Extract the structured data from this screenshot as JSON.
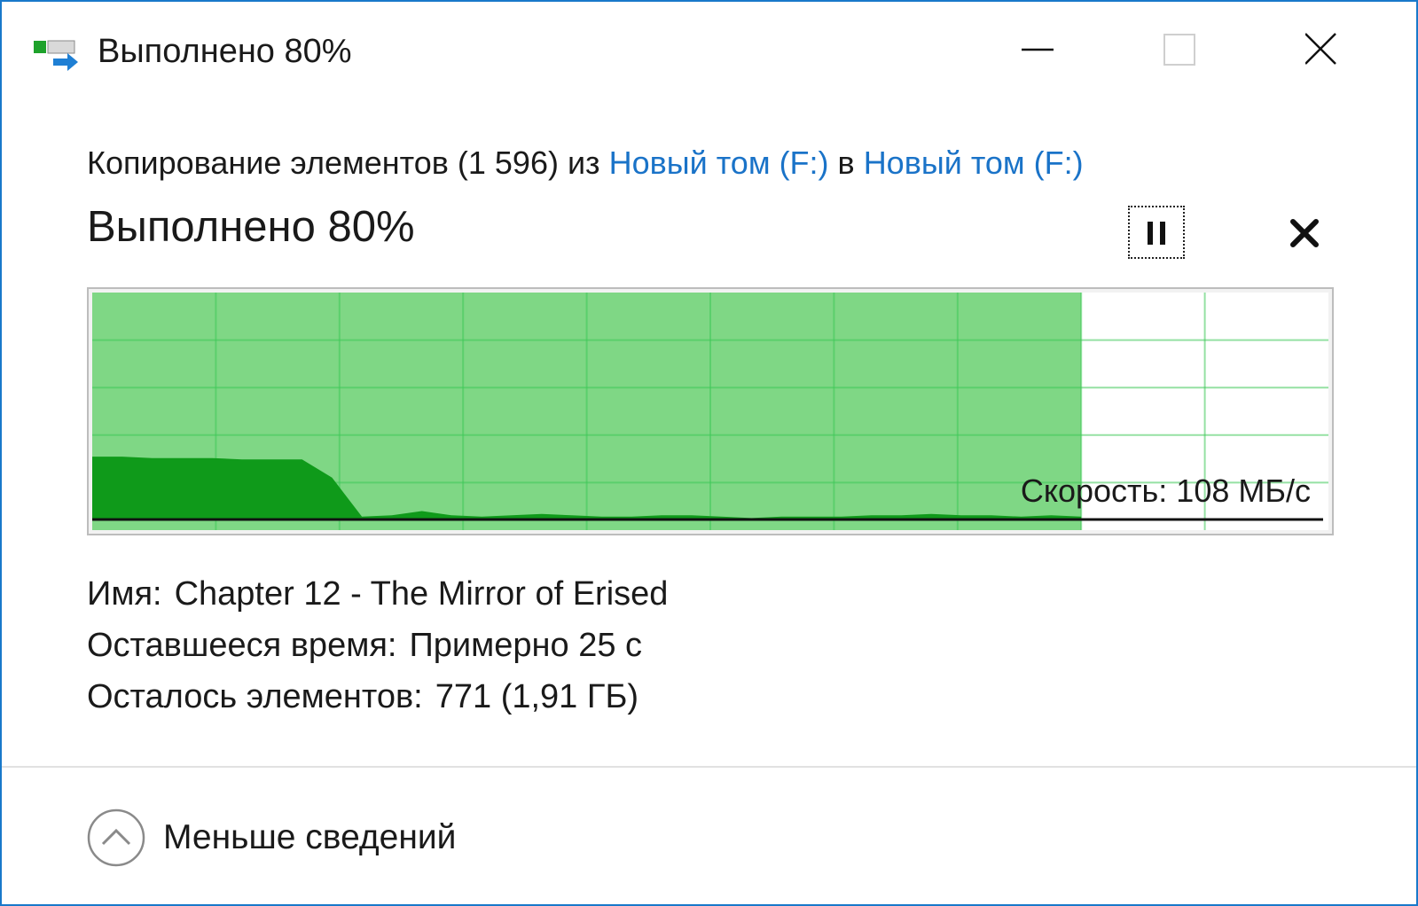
{
  "window": {
    "title": "Выполнено 80%",
    "border_color": "#1979ca"
  },
  "title_buttons": {
    "minimize_icon": "minimize-icon",
    "maximize_icon": "maximize-icon",
    "close_icon": "close-icon"
  },
  "header": {
    "prefix": "Копирование элементов (1 596) из ",
    "source": "Новый том (F:)",
    "middle": " в ",
    "destination": "Новый том (F:)",
    "link_color": "#1a73c8"
  },
  "progress": {
    "title": "Выполнено 80%",
    "fraction": 0.8,
    "pause_icon": "pause-icon",
    "cancel_icon": "cancel-icon"
  },
  "graph": {
    "speed_label": "Скорость: 108 МБ/с",
    "progress_fill_color": "#7fd785",
    "speed_fill_color": "#0f9a1a",
    "grid_color": "#3ec957",
    "speed_profile": [
      0.45,
      0.45,
      0.44,
      0.44,
      0.44,
      0.43,
      0.43,
      0.43,
      0.3,
      0.02,
      0.03,
      0.06,
      0.03,
      0.02,
      0.03,
      0.04,
      0.03,
      0.02,
      0.02,
      0.03,
      0.03,
      0.02,
      0.01,
      0.02,
      0.02,
      0.02,
      0.03,
      0.03,
      0.04,
      0.03,
      0.03,
      0.02,
      0.03,
      0.02
    ]
  },
  "details": {
    "name_label": "Имя:",
    "name_value": "Chapter 12 - The Mirror of Erised",
    "time_label": "Оставшееся время:",
    "time_value": "Примерно 25 с",
    "items_label": "Осталось элементов:",
    "items_value": "771 (1,91 ГБ)"
  },
  "footer": {
    "fewer_details_label": "Меньше сведений",
    "icon": "chevron-up-circle-icon"
  }
}
